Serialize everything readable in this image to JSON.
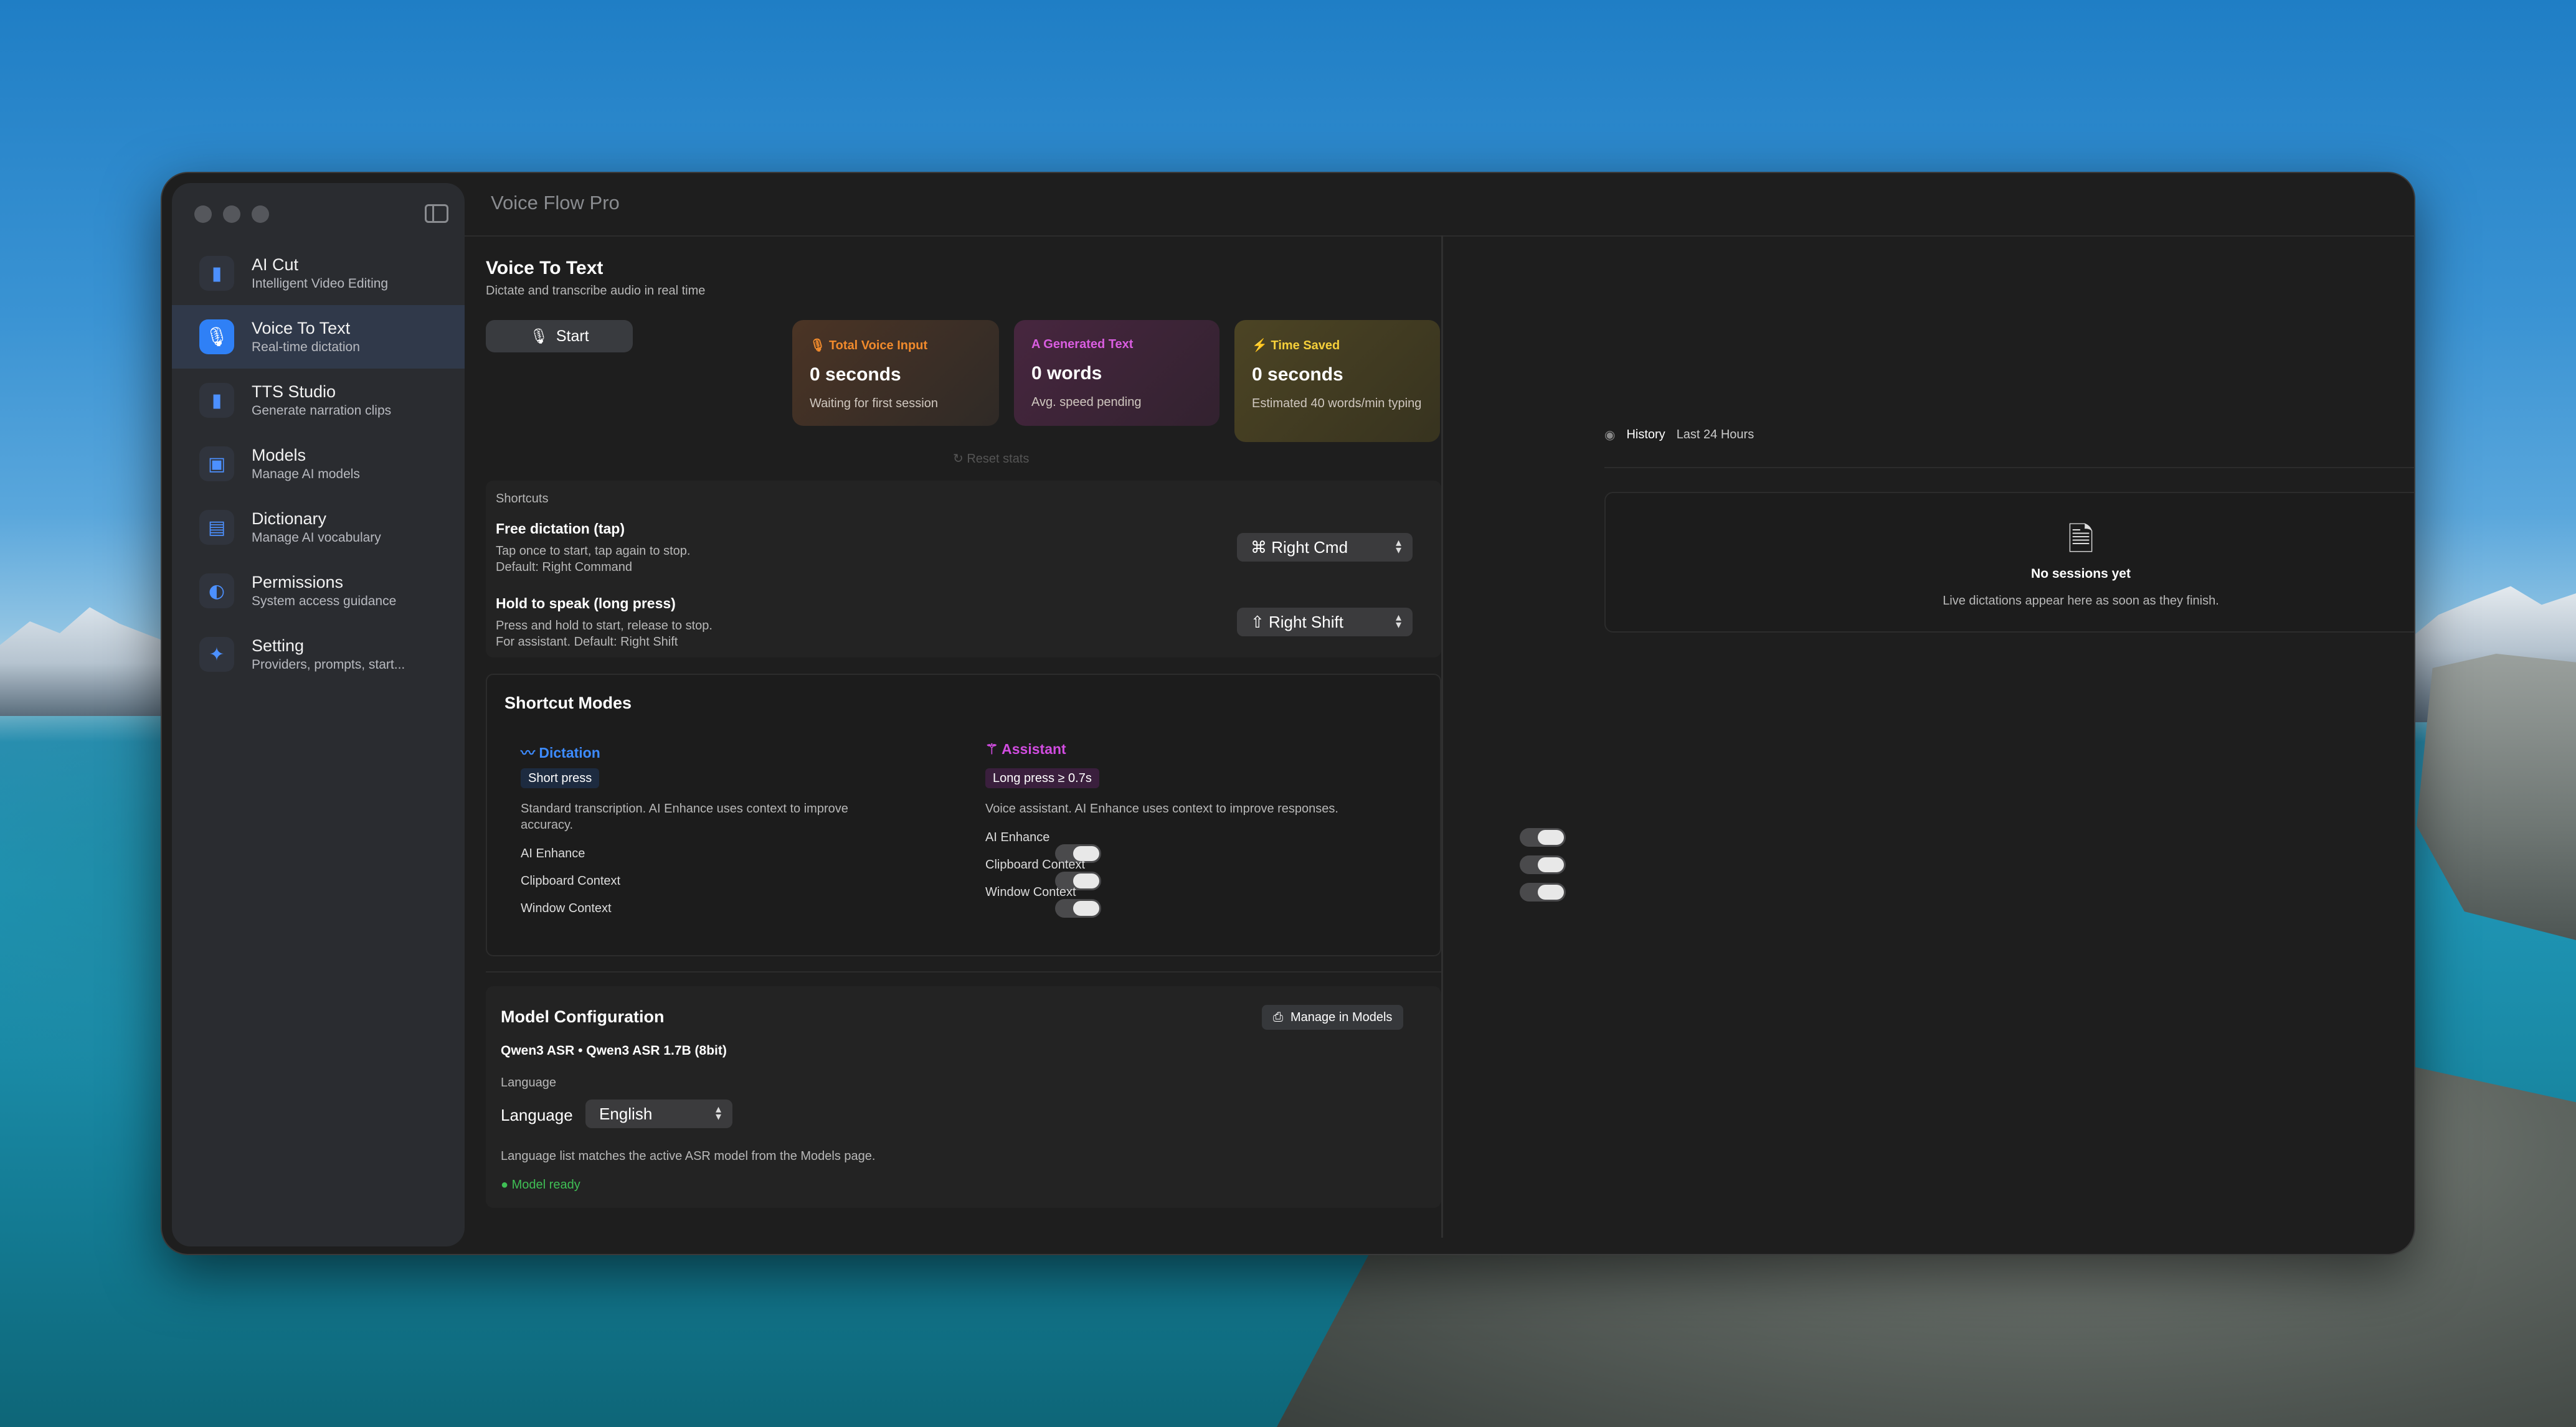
{
  "app": {
    "title": "Voice Flow Pro"
  },
  "sidebar": {
    "items": [
      {
        "title": "AI Cut",
        "subtitle": "Intelligent Video Editing",
        "icon": "waveform-icon"
      },
      {
        "title": "Voice To Text",
        "subtitle": "Real-time dictation",
        "icon": "microphone-icon",
        "active": true
      },
      {
        "title": "TTS Studio",
        "subtitle": "Generate narration clips",
        "icon": "waveform-icon"
      },
      {
        "title": "Models",
        "subtitle": "Manage AI models",
        "icon": "model-box-icon"
      },
      {
        "title": "Dictionary",
        "subtitle": "Manage AI vocabulary",
        "icon": "book-icon"
      },
      {
        "title": "Permissions",
        "subtitle": "System access guidance",
        "icon": "shield-icon"
      },
      {
        "title": "Setting",
        "subtitle": "Providers, prompts, start...",
        "icon": "sparkles-icon"
      }
    ]
  },
  "page": {
    "title": "Voice To Text",
    "subtitle": "Dictate and transcribe audio in real time",
    "start_label": "Start",
    "reset_label": "Reset stats"
  },
  "stats": [
    {
      "title": "Total Voice Input",
      "value": "0 seconds",
      "sub": "Waiting for first session",
      "color": "#f08a2c"
    },
    {
      "title": "Generated Text",
      "value": "0 words",
      "sub": "Avg. speed pending",
      "color": "#d95de0"
    },
    {
      "title": "Time Saved",
      "value": "0 seconds",
      "sub": "Estimated 40 words/min typing",
      "color": "#f5cf3a"
    }
  ],
  "shortcuts": {
    "header": "Shortcuts",
    "free": {
      "title": "Free dictation (tap)",
      "line1": "Tap once to start, tap again to stop.",
      "line2": "Default: Right Command",
      "value": "⌘ Right Cmd"
    },
    "hold": {
      "title": "Hold to speak (long press)",
      "line1": "Press and hold to start, release to stop.",
      "line2": "For assistant. Default: Right Shift",
      "value": "⇧ Right Shift"
    }
  },
  "modes": {
    "title": "Shortcut Modes",
    "dictation": {
      "name": "Dictation",
      "tag": "Short press",
      "desc": "Standard transcription. AI Enhance uses context to improve accuracy.",
      "toggles": [
        "AI Enhance",
        "Clipboard Context",
        "Window Context"
      ]
    },
    "assistant": {
      "name": "Assistant",
      "tag": "Long press ≥ 0.7s",
      "desc": "Voice assistant. AI Enhance uses context to improve responses.",
      "toggles": [
        "AI Enhance",
        "Clipboard Context",
        "Window Context"
      ]
    }
  },
  "model": {
    "title": "Model Configuration",
    "manage_label": "Manage in Models",
    "name": "Qwen3 ASR • Qwen3 ASR 1.7B (8bit)",
    "language_header": "Language",
    "language_label": "Language",
    "language_value": "English",
    "note": "Language list matches the active ASR model from the Models page.",
    "status": "Model ready"
  },
  "history": {
    "label": "History",
    "range": "Last 24 Hours",
    "empty_title": "No sessions yet",
    "empty_sub": "Live dictations appear here as soon as they finish."
  },
  "colors": {
    "accent": "#2f80f6",
    "dictation": "#3d8bff",
    "assistant": "#d14ce0",
    "ready": "#3fbf55"
  }
}
